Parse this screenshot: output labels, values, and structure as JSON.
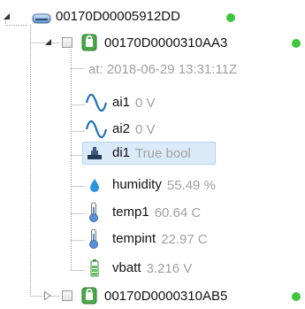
{
  "colors": {
    "status_ok": "#3ec73e",
    "selection_bg": "#dbeaf8",
    "value_text": "#a0a0a0",
    "device_icon": "#2f9e2f",
    "signal_icon": "#1e6fb6"
  },
  "tree": {
    "gateway": {
      "label": "00170D00005912DD",
      "icon": "gateway-icon",
      "status": "online"
    },
    "device1": {
      "label": "00170D0000310AA3",
      "icon": "device-icon",
      "status": "online",
      "expanded": true,
      "timestamp": "at: 2018-06-29 13:31:11Z",
      "channels": [
        {
          "name": "ai1",
          "value": "0 V",
          "icon": "analog-wave-icon"
        },
        {
          "name": "ai2",
          "value": "0 V",
          "icon": "analog-wave-icon"
        },
        {
          "name": "di1",
          "value": "True bool",
          "icon": "digital-input-icon",
          "selected": true
        },
        {
          "name": "humidity",
          "value": "55.49 %",
          "icon": "water-drop-icon"
        },
        {
          "name": "temp1",
          "value": "60.64 C",
          "icon": "thermometer-icon"
        },
        {
          "name": "tempint",
          "value": "22.97 C",
          "icon": "thermometer-icon"
        },
        {
          "name": "vbatt",
          "value": "3.216 V",
          "icon": "battery-icon"
        }
      ]
    },
    "device2": {
      "label": "00170D0000310AB5",
      "icon": "device-icon",
      "status": "online",
      "expanded": false
    }
  }
}
